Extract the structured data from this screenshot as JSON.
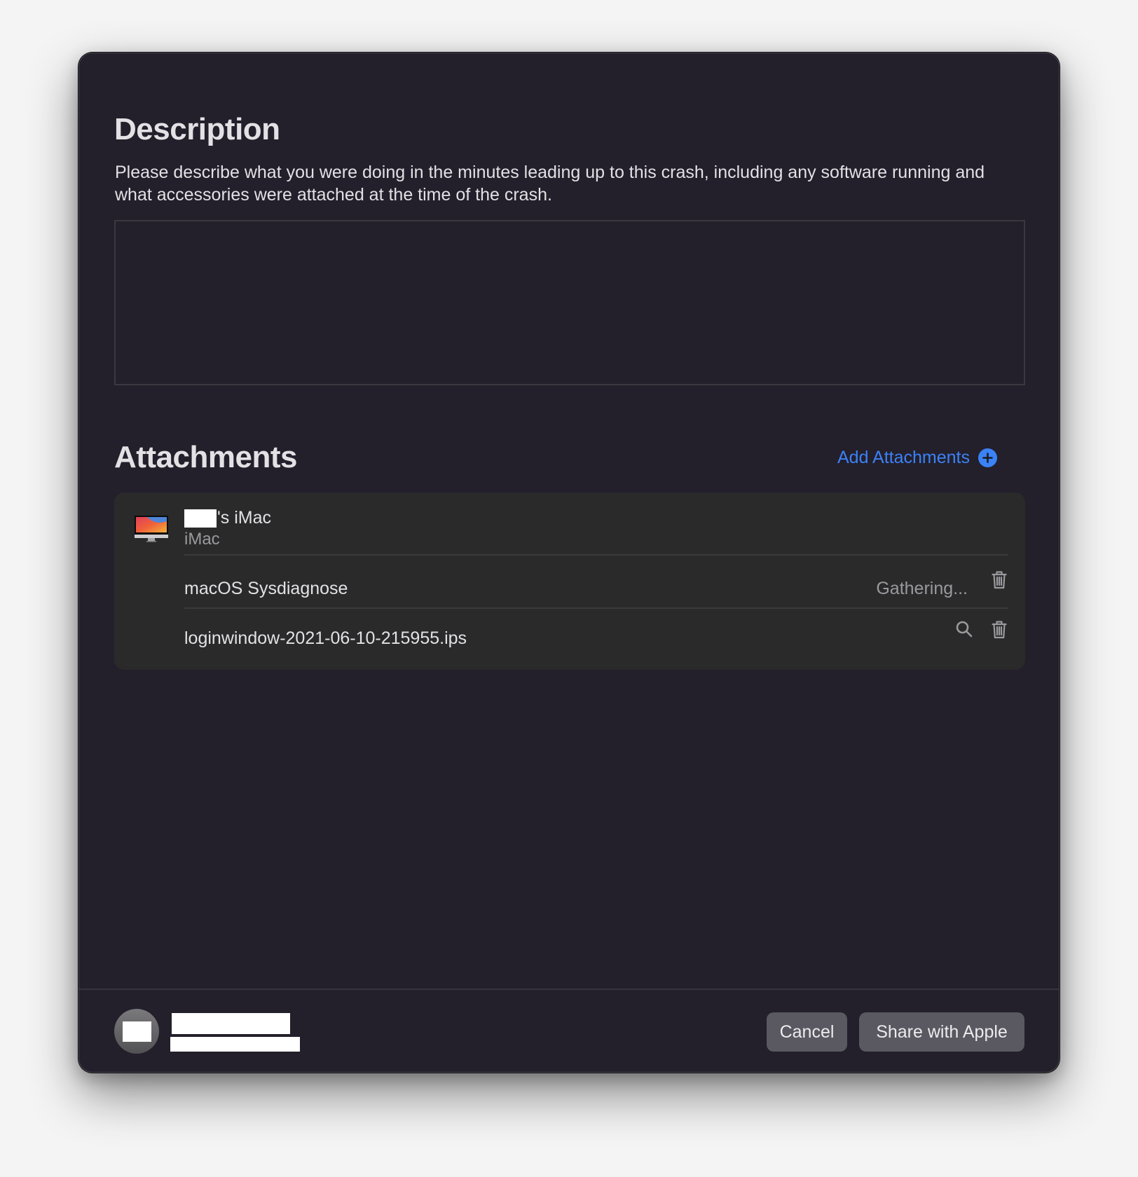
{
  "description": {
    "title": "Description",
    "prompt": "Please describe what you were doing in the minutes leading up to this crash, including any software running and what accessories were attached at the time of the crash.",
    "input_value": "",
    "input_placeholder": ""
  },
  "attachments": {
    "title": "Attachments",
    "add_label": "Add Attachments",
    "add_icon": "plus-circle-icon",
    "accent_color": "#3b82f6",
    "device": {
      "name_suffix": "'s iMac",
      "name_redacted": true,
      "model": "iMac",
      "icon": "imac-icon"
    },
    "items": [
      {
        "label": "macOS Sysdiagnose",
        "status": "Gathering...",
        "actions": [
          "trash-icon"
        ]
      },
      {
        "label": "loginwindow-2021-06-10-215955.ips",
        "status": "",
        "actions": [
          "magnifier-icon",
          "trash-icon"
        ]
      }
    ]
  },
  "footer": {
    "account_redacted": true,
    "cancel_label": "Cancel",
    "share_label": "Share with Apple"
  }
}
